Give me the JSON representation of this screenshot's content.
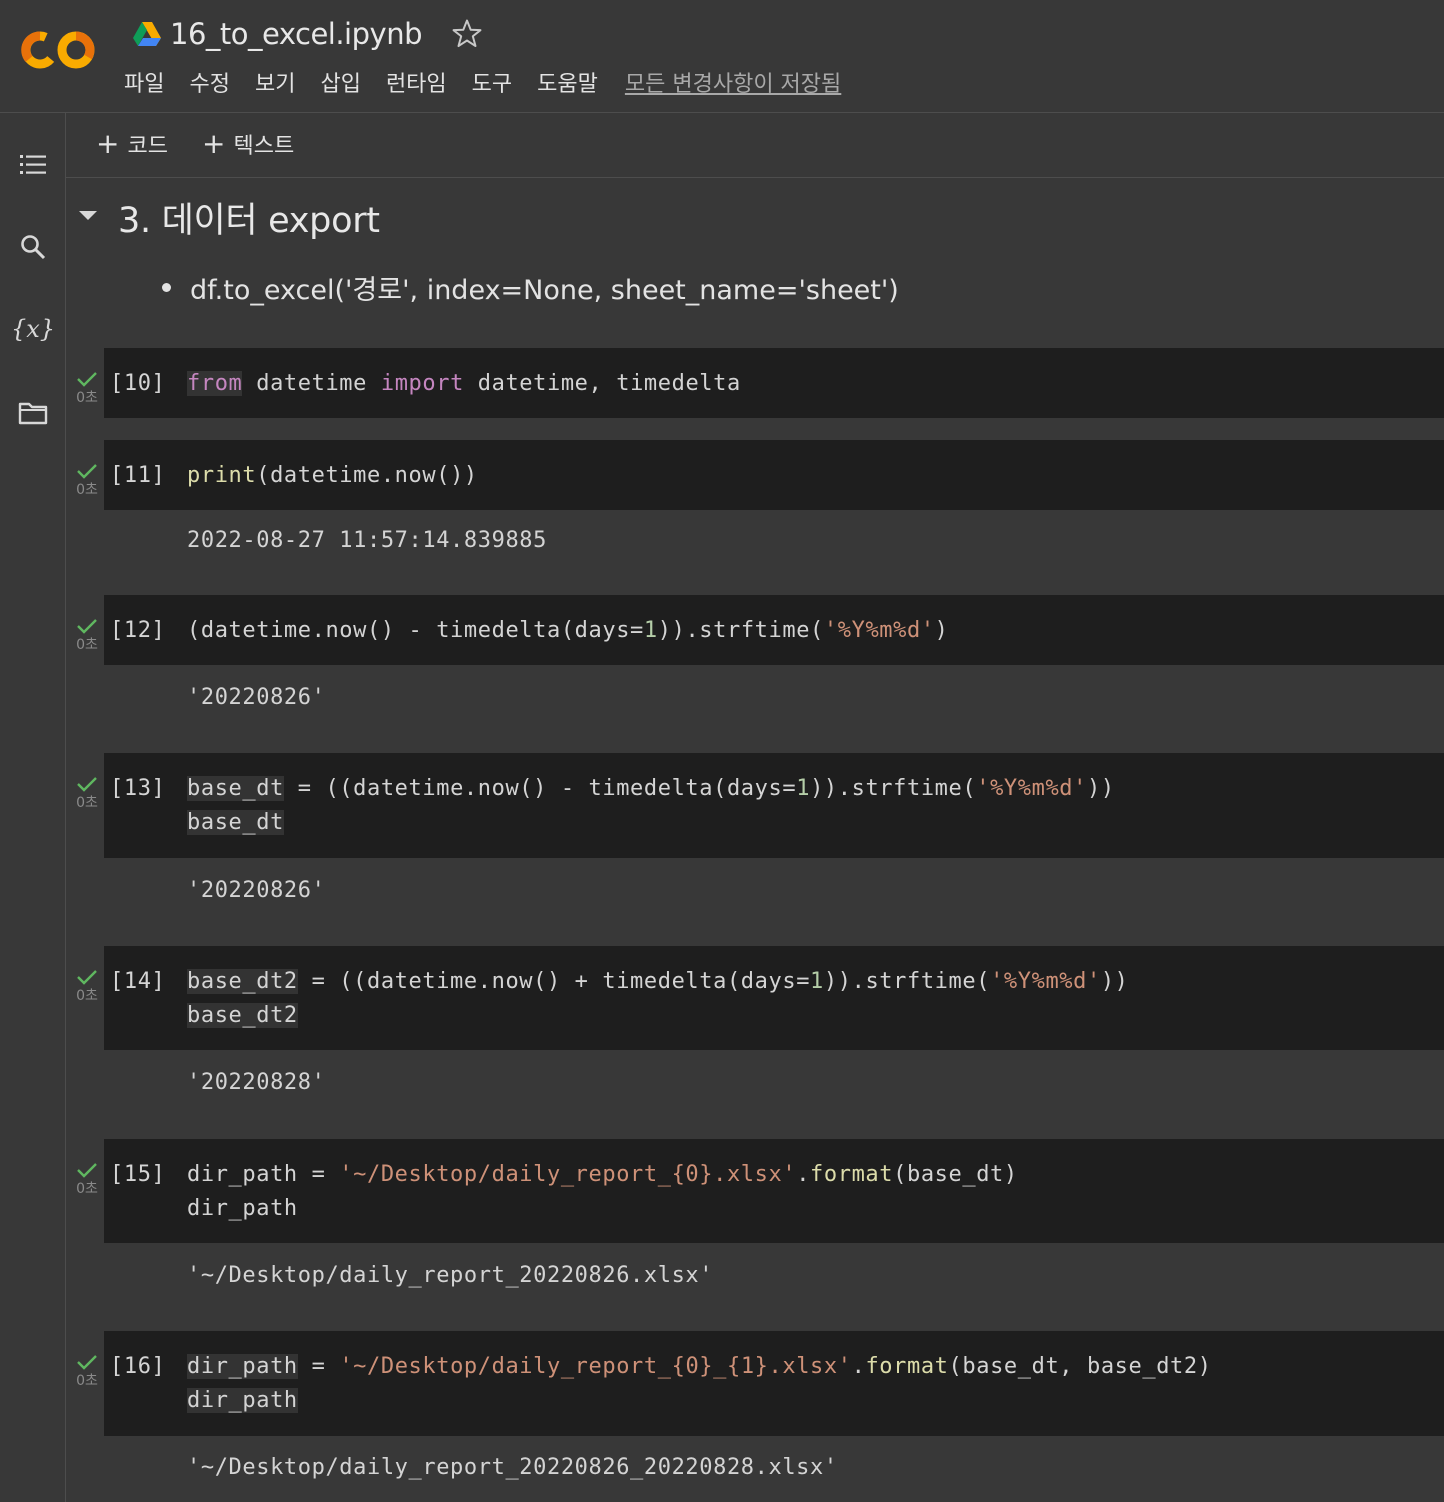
{
  "app": {
    "notebook_title": "16_to_excel.ipynb",
    "menu": [
      "파일",
      "수정",
      "보기",
      "삽입",
      "런타임",
      "도구",
      "도움말"
    ],
    "save_status": "모든 변경사항이 저장됨"
  },
  "toolbar": {
    "add_code_label": "코드",
    "add_text_label": "텍스트",
    "plus": "+"
  },
  "sidebar": {
    "icons": [
      "table-of-contents-icon",
      "search-icon",
      "variables-icon",
      "files-icon"
    ],
    "variables_glyph": "{x}"
  },
  "section": {
    "title": "3. 데이터 export",
    "bullet": "df.to_excel('경로', index=None, sheet_name='sheet')"
  },
  "cells": [
    {
      "prompt": "[10]",
      "elapsed": "0초",
      "lines": [
        "from datetime import datetime, timedelta"
      ],
      "output": ""
    },
    {
      "prompt": "[11]",
      "elapsed": "0초",
      "lines": [
        "print(datetime.now())"
      ],
      "output": "2022-08-27 11:57:14.839885"
    },
    {
      "prompt": "[12]",
      "elapsed": "0초",
      "lines": [
        "(datetime.now() - timedelta(days=1)).strftime('%Y%m%d')"
      ],
      "output": "'20220826'"
    },
    {
      "prompt": "[13]",
      "elapsed": "0초",
      "lines": [
        "base_dt = ((datetime.now() - timedelta(days=1)).strftime('%Y%m%d'))",
        "base_dt"
      ],
      "output": "'20220826'"
    },
    {
      "prompt": "[14]",
      "elapsed": "0초",
      "lines": [
        "base_dt2 = ((datetime.now() + timedelta(days=1)).strftime('%Y%m%d'))",
        "base_dt2"
      ],
      "output": "'20220828'"
    },
    {
      "prompt": "[15]",
      "elapsed": "0초",
      "lines": [
        "dir_path = '~/Desktop/daily_report_{0}.xlsx'.format(base_dt)",
        "dir_path"
      ],
      "output": "'~/Desktop/daily_report_20220826.xlsx'"
    },
    {
      "prompt": "[16]",
      "elapsed": "0초",
      "lines": [
        "dir_path = '~/Desktop/daily_report_{0}_{1}.xlsx'.format(base_dt, base_dt2)",
        "dir_path"
      ],
      "output": "'~/Desktop/daily_report_20220826_20220828.xlsx'"
    }
  ],
  "colors": {
    "background": "#383838",
    "code_bg": "#1e1e1e",
    "keyword": "#c586c0",
    "function": "#dcdcaa",
    "string": "#ce9178",
    "number": "#b5cea8",
    "check": "#5fb760",
    "logo_orange": "#f9ab00",
    "logo_dark_orange": "#e8710a"
  }
}
